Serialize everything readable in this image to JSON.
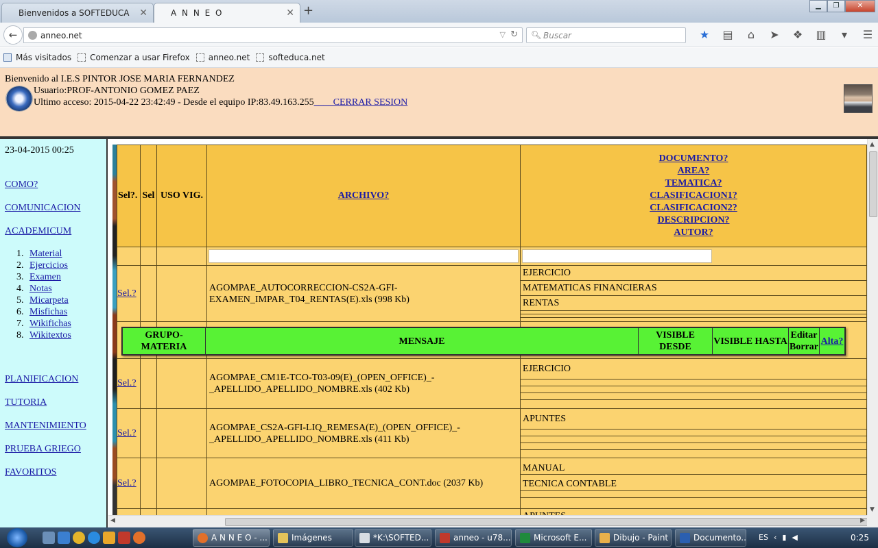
{
  "browser": {
    "tabs": [
      {
        "title": "Bienvenidos a SOFTEDUCA",
        "active": false
      },
      {
        "title": "A N N E O",
        "active": true
      }
    ],
    "url": "anneo.net",
    "search_placeholder": "Buscar",
    "bookmarks": [
      "Más visitados",
      "Comenzar a usar Firefox",
      "anneo.net",
      "softeduca.net"
    ]
  },
  "header": {
    "welcome": "Bienvenido al I.E.S PINTOR JOSE MARIA FERNANDEZ",
    "user": "Usuario:PROF-ANTONIO GOMEZ PAEZ",
    "last_access": "Ultimo acceso: 2015-04-22 23:42:49 - Desde el equipo IP:83.49.163.255",
    "logout": "____CERRAR SESION"
  },
  "sidebar": {
    "date": "23-04-2015 00:25",
    "links": [
      "COMO?",
      "COMUNICACION",
      "ACADEMICUM"
    ],
    "academicum_items": [
      {
        "num": "1.",
        "label": "Material"
      },
      {
        "num": "2.",
        "label": "Ejercicios"
      },
      {
        "num": "3.",
        "label": "Examen"
      },
      {
        "num": "4.",
        "label": "Notas"
      },
      {
        "num": "5.",
        "label": "Micarpeta"
      },
      {
        "num": "6.",
        "label": "Misfichas"
      },
      {
        "num": "7.",
        "label": "Wikifichas"
      },
      {
        "num": "8.",
        "label": "Wikitextos"
      }
    ],
    "bottom_links": [
      "PLANIFICACION",
      "TUTORIA",
      "MANTENIMIENTO",
      "PRUEBA GRIEGO",
      "FAVORITOS"
    ]
  },
  "grid": {
    "headers": {
      "sel_q": "Sel?.",
      "sel": "Sel",
      "uso": "USO VIG.",
      "archivo": "ARCHIVO?",
      "meta": [
        "DOCUMENTO?",
        "AREA?",
        "TEMATICA?",
        "CLASIFICACION1?",
        "CLASIFICACION2?",
        "DESCRIPCION?",
        "AUTOR?"
      ]
    },
    "rows": [
      {
        "sel": "Sel.?",
        "file": "AGOMPAE_AUTOCORRECCION-CS2A-GFI-EXAMEN_IMPAR_T04_RENTAS(E).xls (998 Kb)",
        "meta": [
          "EJERCICIO",
          "MATEMATICAS FINANCIERAS",
          "RENTAS"
        ]
      },
      {
        "sel": "Sel.?",
        "file": "AGOMPAE_CM1E-TCO-T03-09(E)_(OPEN_OFFICE)_-_APELLIDO_APELLIDO_NOMBRE.xls (402 Kb)",
        "meta": [
          "EJERCICIO"
        ]
      },
      {
        "sel": "Sel.?",
        "file": "AGOMPAE_CS2A-GFI-LIQ_REMESA(E)_(OPEN_OFFICE)_-_APELLIDO_APELLIDO_NOMBRE.xls (411 Kb)",
        "meta": [
          "APUNTES"
        ]
      },
      {
        "sel": "Sel.?",
        "file": "AGOMPAE_FOTOCOPIA_LIBRO_TECNICA_CONT.doc (2037 Kb)",
        "meta": [
          "MANUAL",
          "TECNICA CONTABLE"
        ]
      },
      {
        "sel": "",
        "file": "",
        "meta": [
          "APUNTES"
        ]
      }
    ]
  },
  "message_panel": {
    "grupo": "GRUPO-MATERIA",
    "mensaje": "MENSAJE",
    "visible_desde": "VISIBLE DESDE",
    "visible_hasta": "VISIBLE HASTA",
    "editar": "Editar",
    "borrar": "Borrar",
    "alta": "Alta?"
  },
  "taskbar": {
    "tasks": [
      "A N N E O - ...",
      "Imágenes",
      "*K:\\SOFTED...",
      "anneo - u78...",
      "Microsoft E...",
      "Dibujo - Paint",
      "Documento..."
    ],
    "lang": "ES",
    "clock": "0:25"
  }
}
